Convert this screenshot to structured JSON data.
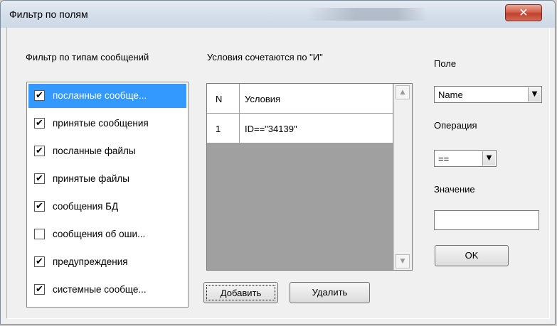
{
  "window": {
    "title": "Фильтр по полям",
    "close_glyph": "✕"
  },
  "filter_types": {
    "label": "Фильтр по типам сообщений",
    "items": [
      {
        "label": "посланные сообще...",
        "checked": true,
        "selected": true
      },
      {
        "label": "принятые сообщения",
        "checked": true,
        "selected": false
      },
      {
        "label": "посланные файлы",
        "checked": true,
        "selected": false
      },
      {
        "label": "принятые файлы",
        "checked": true,
        "selected": false
      },
      {
        "label": "сообщения БД",
        "checked": true,
        "selected": false
      },
      {
        "label": "сообщения об оши...",
        "checked": false,
        "selected": false
      },
      {
        "label": "предупреждения",
        "checked": true,
        "selected": false
      },
      {
        "label": "системные сообще...",
        "checked": true,
        "selected": false
      }
    ],
    "check_glyph": "✔"
  },
  "conditions": {
    "label": "Условия сочетаются по \"И\"",
    "headers": {
      "n": "N",
      "cond": "Условия"
    },
    "rows": [
      {
        "n": "1",
        "cond": "ID==\"34139\""
      }
    ],
    "scroll_up": "▲",
    "scroll_down": "▼"
  },
  "field": {
    "label": "Поле",
    "value": "Name"
  },
  "operation": {
    "label": "Операция",
    "value": "=="
  },
  "value": {
    "label": "Значение",
    "text": ""
  },
  "buttons": {
    "ok": "OK",
    "add": "Добавить",
    "delete": "Удалить"
  },
  "dropdown_glyph": "▼"
}
